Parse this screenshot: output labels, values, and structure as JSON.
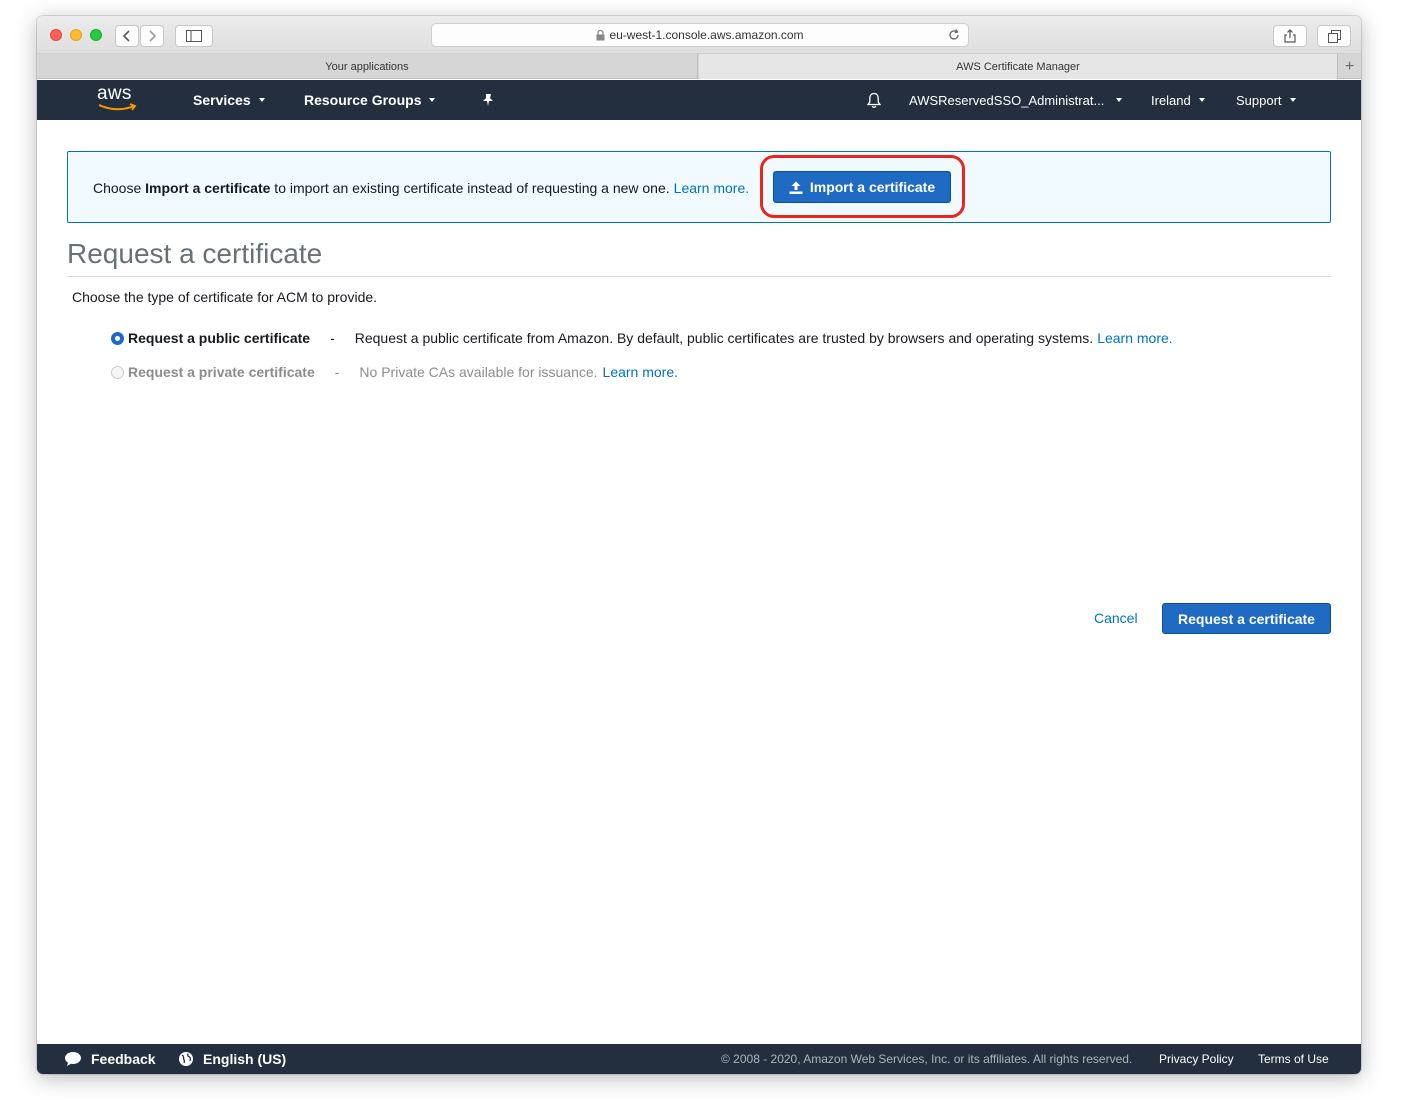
{
  "browser": {
    "url": "eu-west-1.console.aws.amazon.com",
    "tabs": [
      {
        "label": "Your applications",
        "active": false
      },
      {
        "label": "AWS Certificate Manager",
        "active": true
      }
    ]
  },
  "nav": {
    "logo": "aws",
    "services": "Services",
    "resource_groups": "Resource Groups",
    "account": "AWSReservedSSO_Administrat...",
    "region": "Ireland",
    "support": "Support"
  },
  "banner": {
    "text_prefix": "Choose ",
    "text_bold": "Import a certificate",
    "text_suffix": " to import an existing certificate instead of requesting a new one.",
    "learn_more": "Learn more.",
    "import_button": "Import a certificate"
  },
  "main": {
    "title": "Request a certificate",
    "subtitle": "Choose the type of certificate for ACM to provide.",
    "options": [
      {
        "label": "Request a public certificate",
        "dash": "-",
        "description": "Request a public certificate from Amazon. By default, public certificates are trusted by browsers and operating systems.",
        "learn_more": "Learn more.",
        "selected": true,
        "enabled": true
      },
      {
        "label": "Request a private certificate",
        "dash": "-",
        "description": "No Private CAs available for issuance.",
        "learn_more": "Learn more.",
        "selected": false,
        "enabled": false
      }
    ],
    "cancel": "Cancel",
    "submit": "Request a certificate"
  },
  "footer": {
    "feedback": "Feedback",
    "language": "English (US)",
    "copyright": "© 2008 - 2020, Amazon Web Services, Inc. or its affiliates. All rights reserved.",
    "privacy": "Privacy Policy",
    "terms": "Terms of Use"
  },
  "colors": {
    "nav_bg": "#232f3e",
    "primary": "#1f6ac3",
    "link": "#0073bb",
    "highlight": "#e6261f",
    "aws_orange": "#ff9900"
  }
}
